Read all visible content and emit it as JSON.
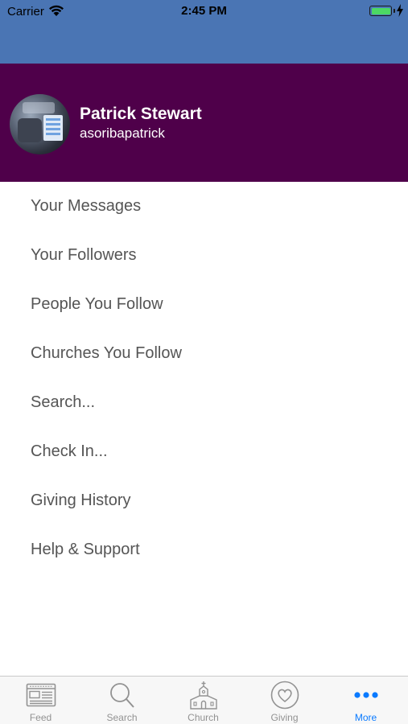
{
  "status_bar": {
    "carrier": "Carrier",
    "time": "2:45 PM",
    "battery_level": 1.0,
    "battery_color": "#4cd964"
  },
  "colors": {
    "nav_bar": "#4a75b4",
    "profile_background": "#4f004a",
    "active_tab": "#0a7aff",
    "inactive_tab": "#929292"
  },
  "profile": {
    "name": "Patrick Stewart",
    "handle": "asoribapatrick",
    "avatar_icon": "user-photo"
  },
  "menu": {
    "items": [
      {
        "label": "Your Messages"
      },
      {
        "label": "Your Followers"
      },
      {
        "label": "People You Follow"
      },
      {
        "label": "Churches You Follow"
      },
      {
        "label": "Search..."
      },
      {
        "label": "Check In..."
      },
      {
        "label": "Giving History"
      },
      {
        "label": "Help & Support"
      }
    ]
  },
  "tabs": [
    {
      "label": "Feed",
      "icon": "newspaper-icon",
      "active": false
    },
    {
      "label": "Search",
      "icon": "search-icon",
      "active": false
    },
    {
      "label": "Church",
      "icon": "church-icon",
      "active": false
    },
    {
      "label": "Giving",
      "icon": "heart-icon",
      "active": false
    },
    {
      "label": "More",
      "icon": "more-dots-icon",
      "active": true
    }
  ]
}
